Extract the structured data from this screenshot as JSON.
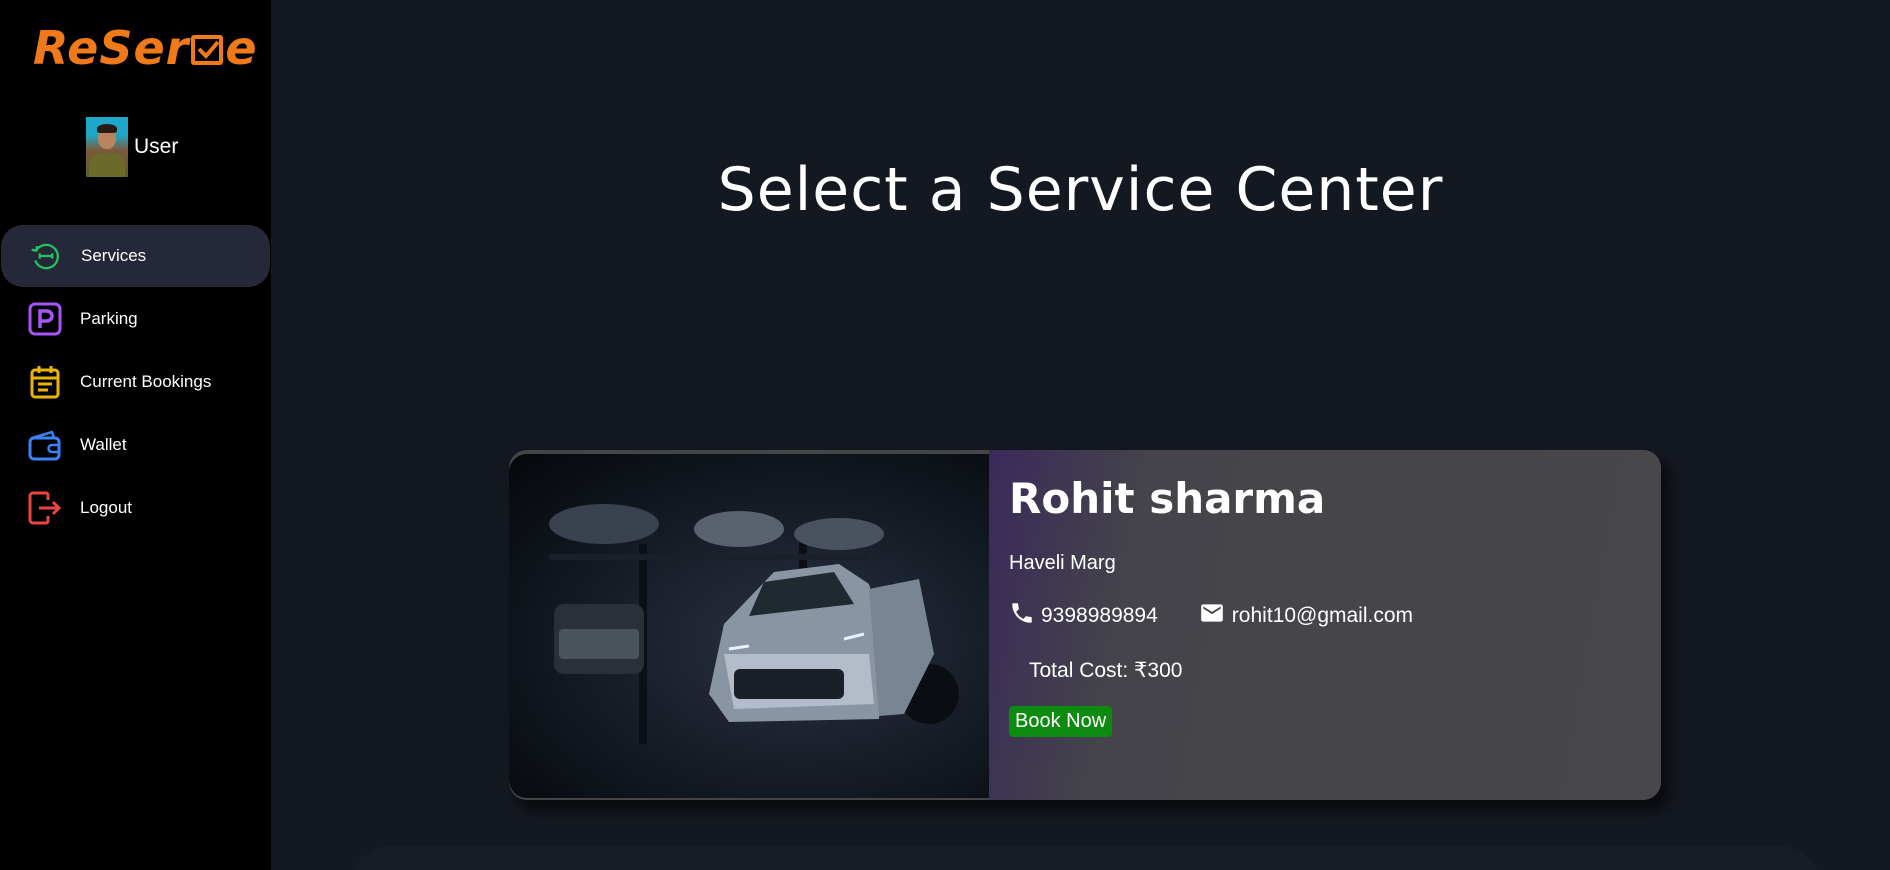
{
  "brand": {
    "logo_text_part1": "ReSer",
    "logo_text_part2": "e",
    "color": "#f07a1a"
  },
  "user": {
    "name": "User"
  },
  "sidebar": {
    "items": [
      {
        "label": "Services",
        "icon": "wrench-cycle-icon",
        "color": "#22c55e",
        "active": true
      },
      {
        "label": "Parking",
        "icon": "parking-icon",
        "color": "#a855f7",
        "active": false
      },
      {
        "label": "Current Bookings",
        "icon": "calendar-icon",
        "color": "#eab308",
        "active": false
      },
      {
        "label": "Wallet",
        "icon": "wallet-icon",
        "color": "#3b82f6",
        "active": false
      },
      {
        "label": "Logout",
        "icon": "logout-icon",
        "color": "#ef4444",
        "active": false
      }
    ]
  },
  "main": {
    "title": "Select a Service Center",
    "card": {
      "name": "Rohit sharma",
      "address": "Haveli Marg",
      "phone": "9398989894",
      "email": "rohit10@gmail.com",
      "total_cost": "Total Cost: ₹300",
      "book_label": "Book Now",
      "book_color": "#0d8a10"
    }
  }
}
